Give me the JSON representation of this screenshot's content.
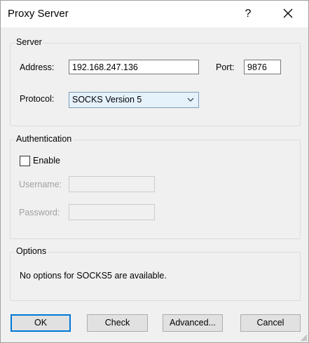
{
  "window": {
    "title": "Proxy Server",
    "help_glyph": "?",
    "close_icon": "close-icon"
  },
  "server": {
    "group_label": "Server",
    "address_label": "Address:",
    "address_value": "192.168.247.136",
    "port_label": "Port:",
    "port_value": "9876",
    "protocol_label": "Protocol:",
    "protocol_value": "SOCKS Version 5"
  },
  "authentication": {
    "group_label": "Authentication",
    "enable_label": "Enable",
    "enable_checked": false,
    "username_label": "Username:",
    "username_value": "",
    "password_label": "Password:",
    "password_value": ""
  },
  "options": {
    "group_label": "Options",
    "message": "No options for SOCKS5 are available."
  },
  "buttons": {
    "ok": "OK",
    "check": "Check",
    "advanced": "Advanced...",
    "cancel": "Cancel"
  },
  "colors": {
    "dialog_bg": "#f0f0f0",
    "accent": "#0078d7",
    "select_bg": "#e5f1fb"
  }
}
